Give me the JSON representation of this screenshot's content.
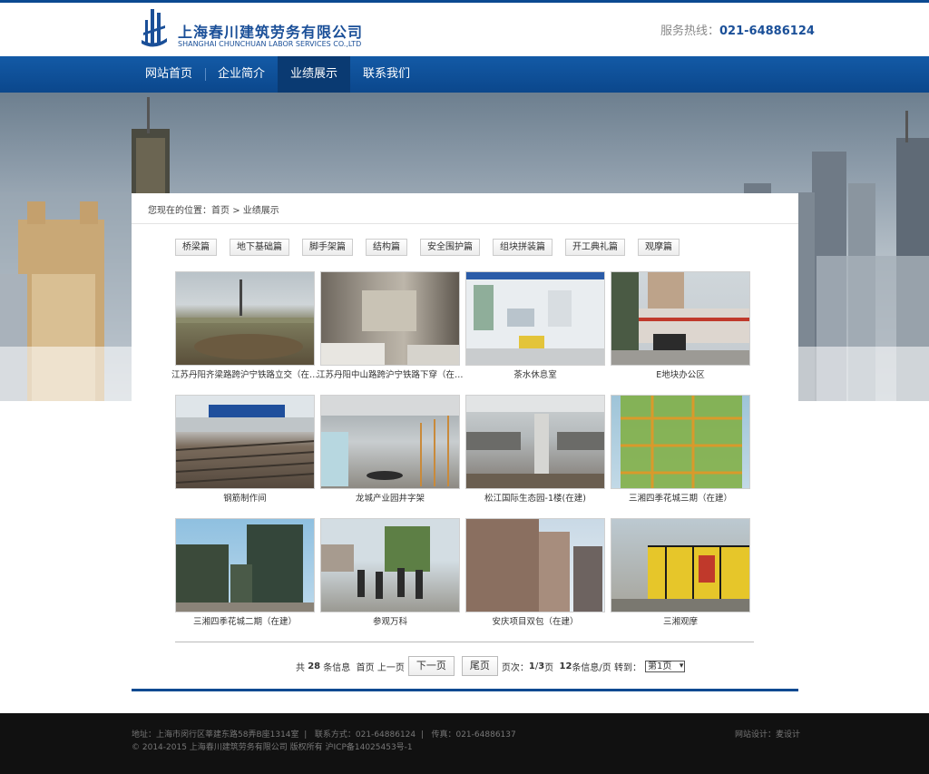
{
  "header": {
    "logo_cn": "上海春川建筑劳务有限公司",
    "logo_en": "SHANGHAI CHUNCHUAN LABOR SERVICES CO.,LTD",
    "hotline_label": "服务热线：",
    "hotline_number": "021-64886124",
    "brand_color": "#0c4a91"
  },
  "nav": {
    "items": [
      "网站首页",
      "企业简介",
      "业绩展示",
      "联系我们"
    ],
    "active": "业绩展示"
  },
  "breadcrumb": {
    "prefix": "您现在的位置：",
    "home": "首页",
    "separator": ">",
    "current": "业绩展示"
  },
  "categories": [
    "桥梁篇",
    "地下基础篇",
    "脚手架篇",
    "结构篇",
    "安全围护篇",
    "组块拼装篇",
    "开工典礼篇",
    "观摩篇"
  ],
  "gallery": [
    {
      "caption": "江苏丹阳齐梁路跨沪宁铁路立交（在建）"
    },
    {
      "caption": "江苏丹阳中山路跨沪宁铁路下穿（在建）"
    },
    {
      "caption": "茶水休息室"
    },
    {
      "caption": "E地块办公区"
    },
    {
      "caption": "钢筋制作间"
    },
    {
      "caption": "龙城产业园井字架"
    },
    {
      "caption": "松江国际生态园-1楼(在建)"
    },
    {
      "caption": "三湘四季花城三期（在建）"
    },
    {
      "caption": "三湘四季花城二期（在建）"
    },
    {
      "caption": "参观万科"
    },
    {
      "caption": "安庆项目双包（在建）"
    },
    {
      "caption": "三湘观摩"
    }
  ],
  "pager": {
    "total_prefix": "共",
    "total": "28",
    "total_suffix": "条信息",
    "first": "首页",
    "prev": "上一页",
    "next": "下一页",
    "last": "尾页",
    "page_label": "页次：",
    "page_current": "1",
    "page_sep": "/",
    "page_total": "3",
    "page_suffix": "页",
    "per_page": "12",
    "per_page_suffix": "条信息/页",
    "goto_label": "转到：",
    "goto_value": "第1页"
  },
  "footer": {
    "address": "地址：上海市闵行区莘建东路58弄B座1314室",
    "contact": "联系方式：021-64886124",
    "fax": "传真：021-64886137",
    "copyright": "© 2014-2015 上海春川建筑劳务有限公司 版权所有 沪ICP备14025453号-1",
    "design": "网站设计：",
    "designer": "麦设计"
  }
}
